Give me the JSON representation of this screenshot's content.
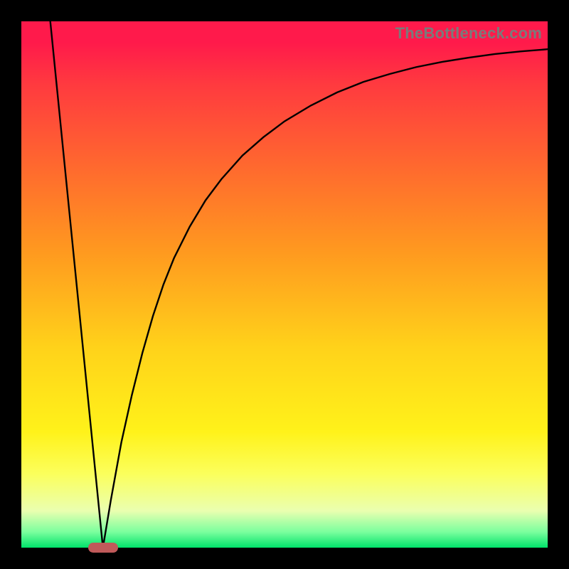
{
  "watermark": "TheBottleneck.com",
  "colors": {
    "frame": "#000000",
    "marker": "#c05a5a",
    "curve": "#000000",
    "gradient_top": "#ff1a4b",
    "gradient_bottom": "#00e36a"
  },
  "chart_data": {
    "type": "line",
    "title": "",
    "xlabel": "",
    "ylabel": "",
    "xlim": [
      0,
      100
    ],
    "ylim": [
      0,
      100
    ],
    "grid": false,
    "legend": false,
    "annotations": [
      {
        "name": "cusp-marker",
        "x": 15.5,
        "y": 0
      }
    ],
    "series": [
      {
        "name": "left-branch",
        "x": [
          5.5,
          7,
          8,
          9,
          10,
          11,
          12,
          13,
          14,
          15,
          15.5
        ],
        "values": [
          100,
          85,
          75,
          65,
          55,
          45,
          35,
          25,
          15,
          5,
          0
        ]
      },
      {
        "name": "right-branch",
        "x": [
          15.5,
          17,
          19,
          21,
          23,
          25,
          27,
          29,
          32,
          35,
          38,
          42,
          46,
          50,
          55,
          60,
          65,
          70,
          75,
          80,
          85,
          90,
          95,
          100
        ],
        "values": [
          0,
          9,
          20,
          29,
          37,
          44,
          50,
          55,
          61,
          66,
          70,
          74.5,
          78,
          81,
          84,
          86.5,
          88.5,
          90,
          91.3,
          92.3,
          93.1,
          93.8,
          94.3,
          94.7
        ]
      }
    ]
  }
}
